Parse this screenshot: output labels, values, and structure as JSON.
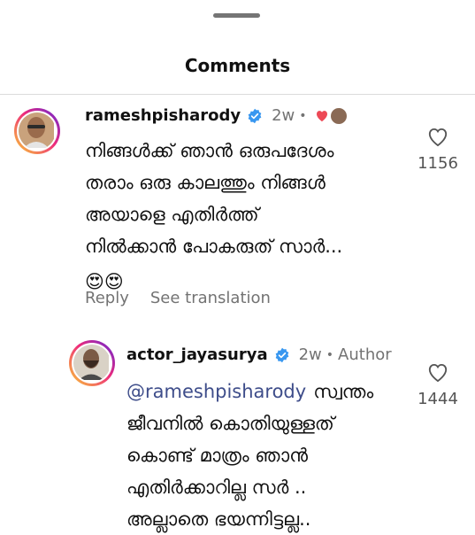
{
  "sheet": {
    "title": "Comments"
  },
  "comments": [
    {
      "username": "rameshpisharody",
      "time": "2w",
      "lines": [
        "നിങ്ങൾക്ക് ഞാൻ ഒരുപദേശം",
        "തരാം ഒരു കാലത്തും നിങ്ങൾ",
        "അയാളെ എതിർത്ത്",
        "നിൽക്കാൻ പോകരുത് സാർ..."
      ],
      "emoji": "😍😍",
      "reply_label": "Reply",
      "translate_label": "See translation",
      "likes": "1156"
    },
    {
      "username": "actor_jayasurya",
      "time": "2w",
      "author_label": "Author",
      "mention": "@rameshpisharody",
      "lines": [
        "സ്വന്തം",
        "ജീവനിൽ കൊതിയുള്ളത്",
        "കൊണ്ട് മാത്രം ഞാൻ",
        "എതിർക്കാറില്ല സർ ..",
        "അല്ലാതെ ഭയന്നിട്ടല്ല.."
      ],
      "likes": "1444"
    }
  ],
  "icons": {
    "like": "heart-outline-icon",
    "verified": "verified-badge-icon",
    "liked_by_author": "red-heart-icon"
  },
  "colors": {
    "verified": "#3897f0",
    "mention": "#3e4d8a",
    "muted": "#737373",
    "heart": "#ed4956"
  }
}
